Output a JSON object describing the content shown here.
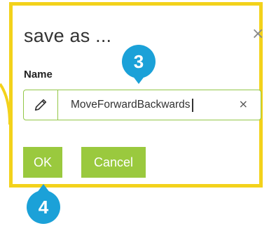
{
  "dialog": {
    "title": "save as ...",
    "close_icon": "close-icon",
    "name_label": "Name",
    "input": {
      "value": "MoveForwardBackwards",
      "leading_icon": "pencil-icon",
      "clear_icon": "clear-icon"
    },
    "buttons": {
      "ok_label": "OK",
      "cancel_label": "Cancel"
    }
  },
  "annotations": {
    "step_3": "3",
    "step_4": "4"
  },
  "colors": {
    "highlight_frame": "#f3d21b",
    "accent_green": "#9ac93e",
    "badge_blue": "#1ba1d8"
  }
}
